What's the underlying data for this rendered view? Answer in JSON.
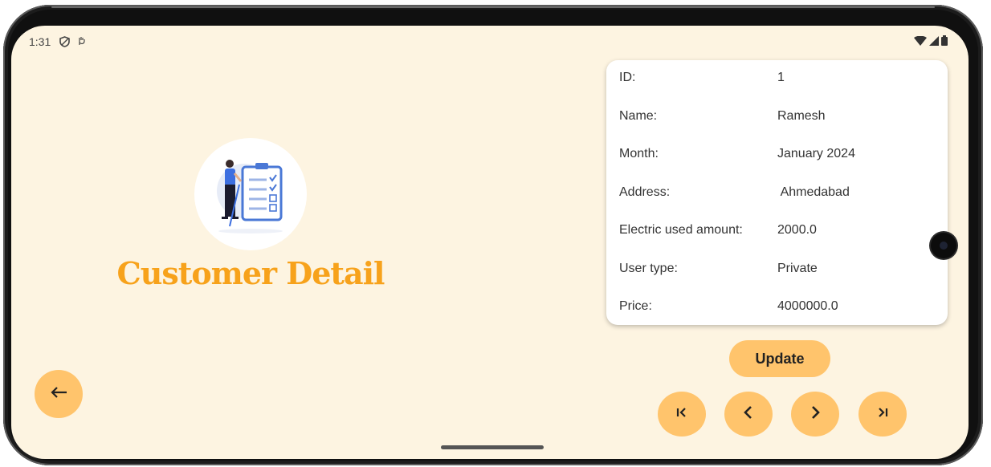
{
  "status_bar": {
    "time": "1:31",
    "icons": [
      "shield-icon",
      "hand-icon",
      "wifi-icon",
      "signal-icon",
      "battery-icon"
    ]
  },
  "page": {
    "title": "Customer Detail",
    "illustration": "checklist-illustration"
  },
  "details": [
    {
      "label": "ID:",
      "value": "1"
    },
    {
      "label": "Name:",
      "value": "Ramesh"
    },
    {
      "label": "Month:",
      "value": "January 2024"
    },
    {
      "label": "Address:",
      "value": " Ahmedabad"
    },
    {
      "label": "Electric used amount:",
      "value": "2000.0"
    },
    {
      "label": "User type:",
      "value": "Private"
    },
    {
      "label": "Price:",
      "value": "4000000.0"
    }
  ],
  "actions": {
    "update_label": "Update",
    "back_icon": "arrow-left-icon",
    "nav_icons": [
      "first-record-icon",
      "previous-icon",
      "next-icon",
      "last-record-icon"
    ]
  },
  "colors": {
    "background": "#fdf4e1",
    "accent": "#ffc46c",
    "title": "#f7a21b"
  }
}
